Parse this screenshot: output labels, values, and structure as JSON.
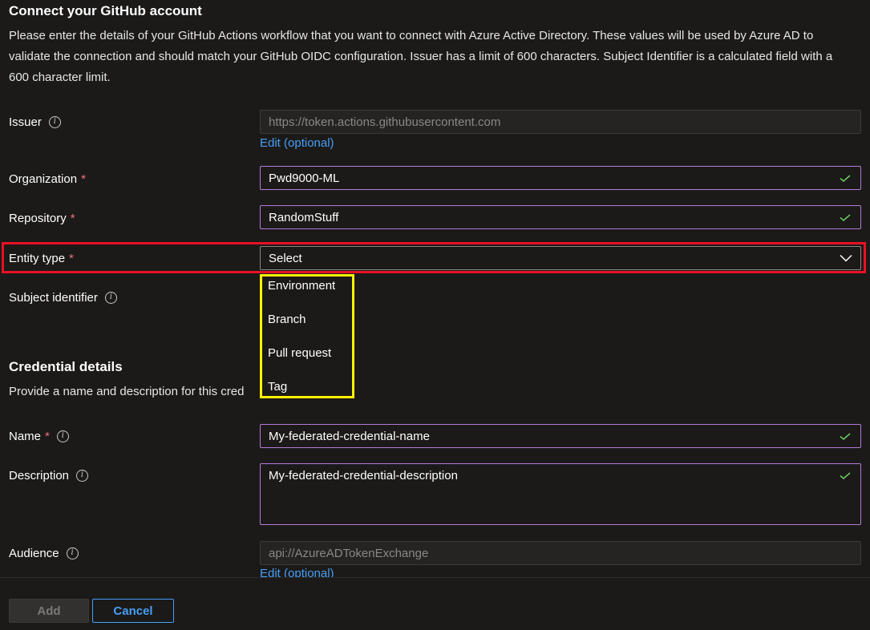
{
  "section1": {
    "title": "Connect your GitHub account",
    "description": "Please enter the details of your GitHub Actions workflow that you want to connect with Azure Active Directory. These values will be used by Azure AD to validate the connection and should match your GitHub OIDC configuration. Issuer has a limit of 600 characters. Subject Identifier is a calculated field with a 600 character limit."
  },
  "issuer": {
    "label": "Issuer",
    "value": "https://token.actions.githubusercontent.com",
    "edit_link": "Edit (optional)"
  },
  "organization": {
    "label": "Organization",
    "value": "Pwd9000-ML"
  },
  "repository": {
    "label": "Repository",
    "value": "RandomStuff"
  },
  "entity_type": {
    "label": "Entity type",
    "selected": "Select",
    "options": [
      "Environment",
      "Branch",
      "Pull request",
      "Tag"
    ]
  },
  "subject_identifier": {
    "label": "Subject identifier"
  },
  "section2": {
    "title": "Credential details",
    "description": "Provide a name and description for this cred"
  },
  "name": {
    "label": "Name",
    "value": "My-federated-credential-name"
  },
  "description_field": {
    "label": "Description",
    "value": "My-federated-credential-description"
  },
  "audience": {
    "label": "Audience",
    "value": "api://AzureADTokenExchange",
    "edit_link": "Edit (optional)"
  },
  "required_marker": "*",
  "info_glyph": "i",
  "buttons": {
    "add": "Add",
    "cancel": "Cancel"
  },
  "colors": {
    "background": "#1b1a19",
    "accent_link": "#479ef5",
    "valid_check": "#6ccb5f",
    "required": "#f1707b",
    "highlight_red": "#e81123",
    "highlight_yellow": "#fff100"
  }
}
